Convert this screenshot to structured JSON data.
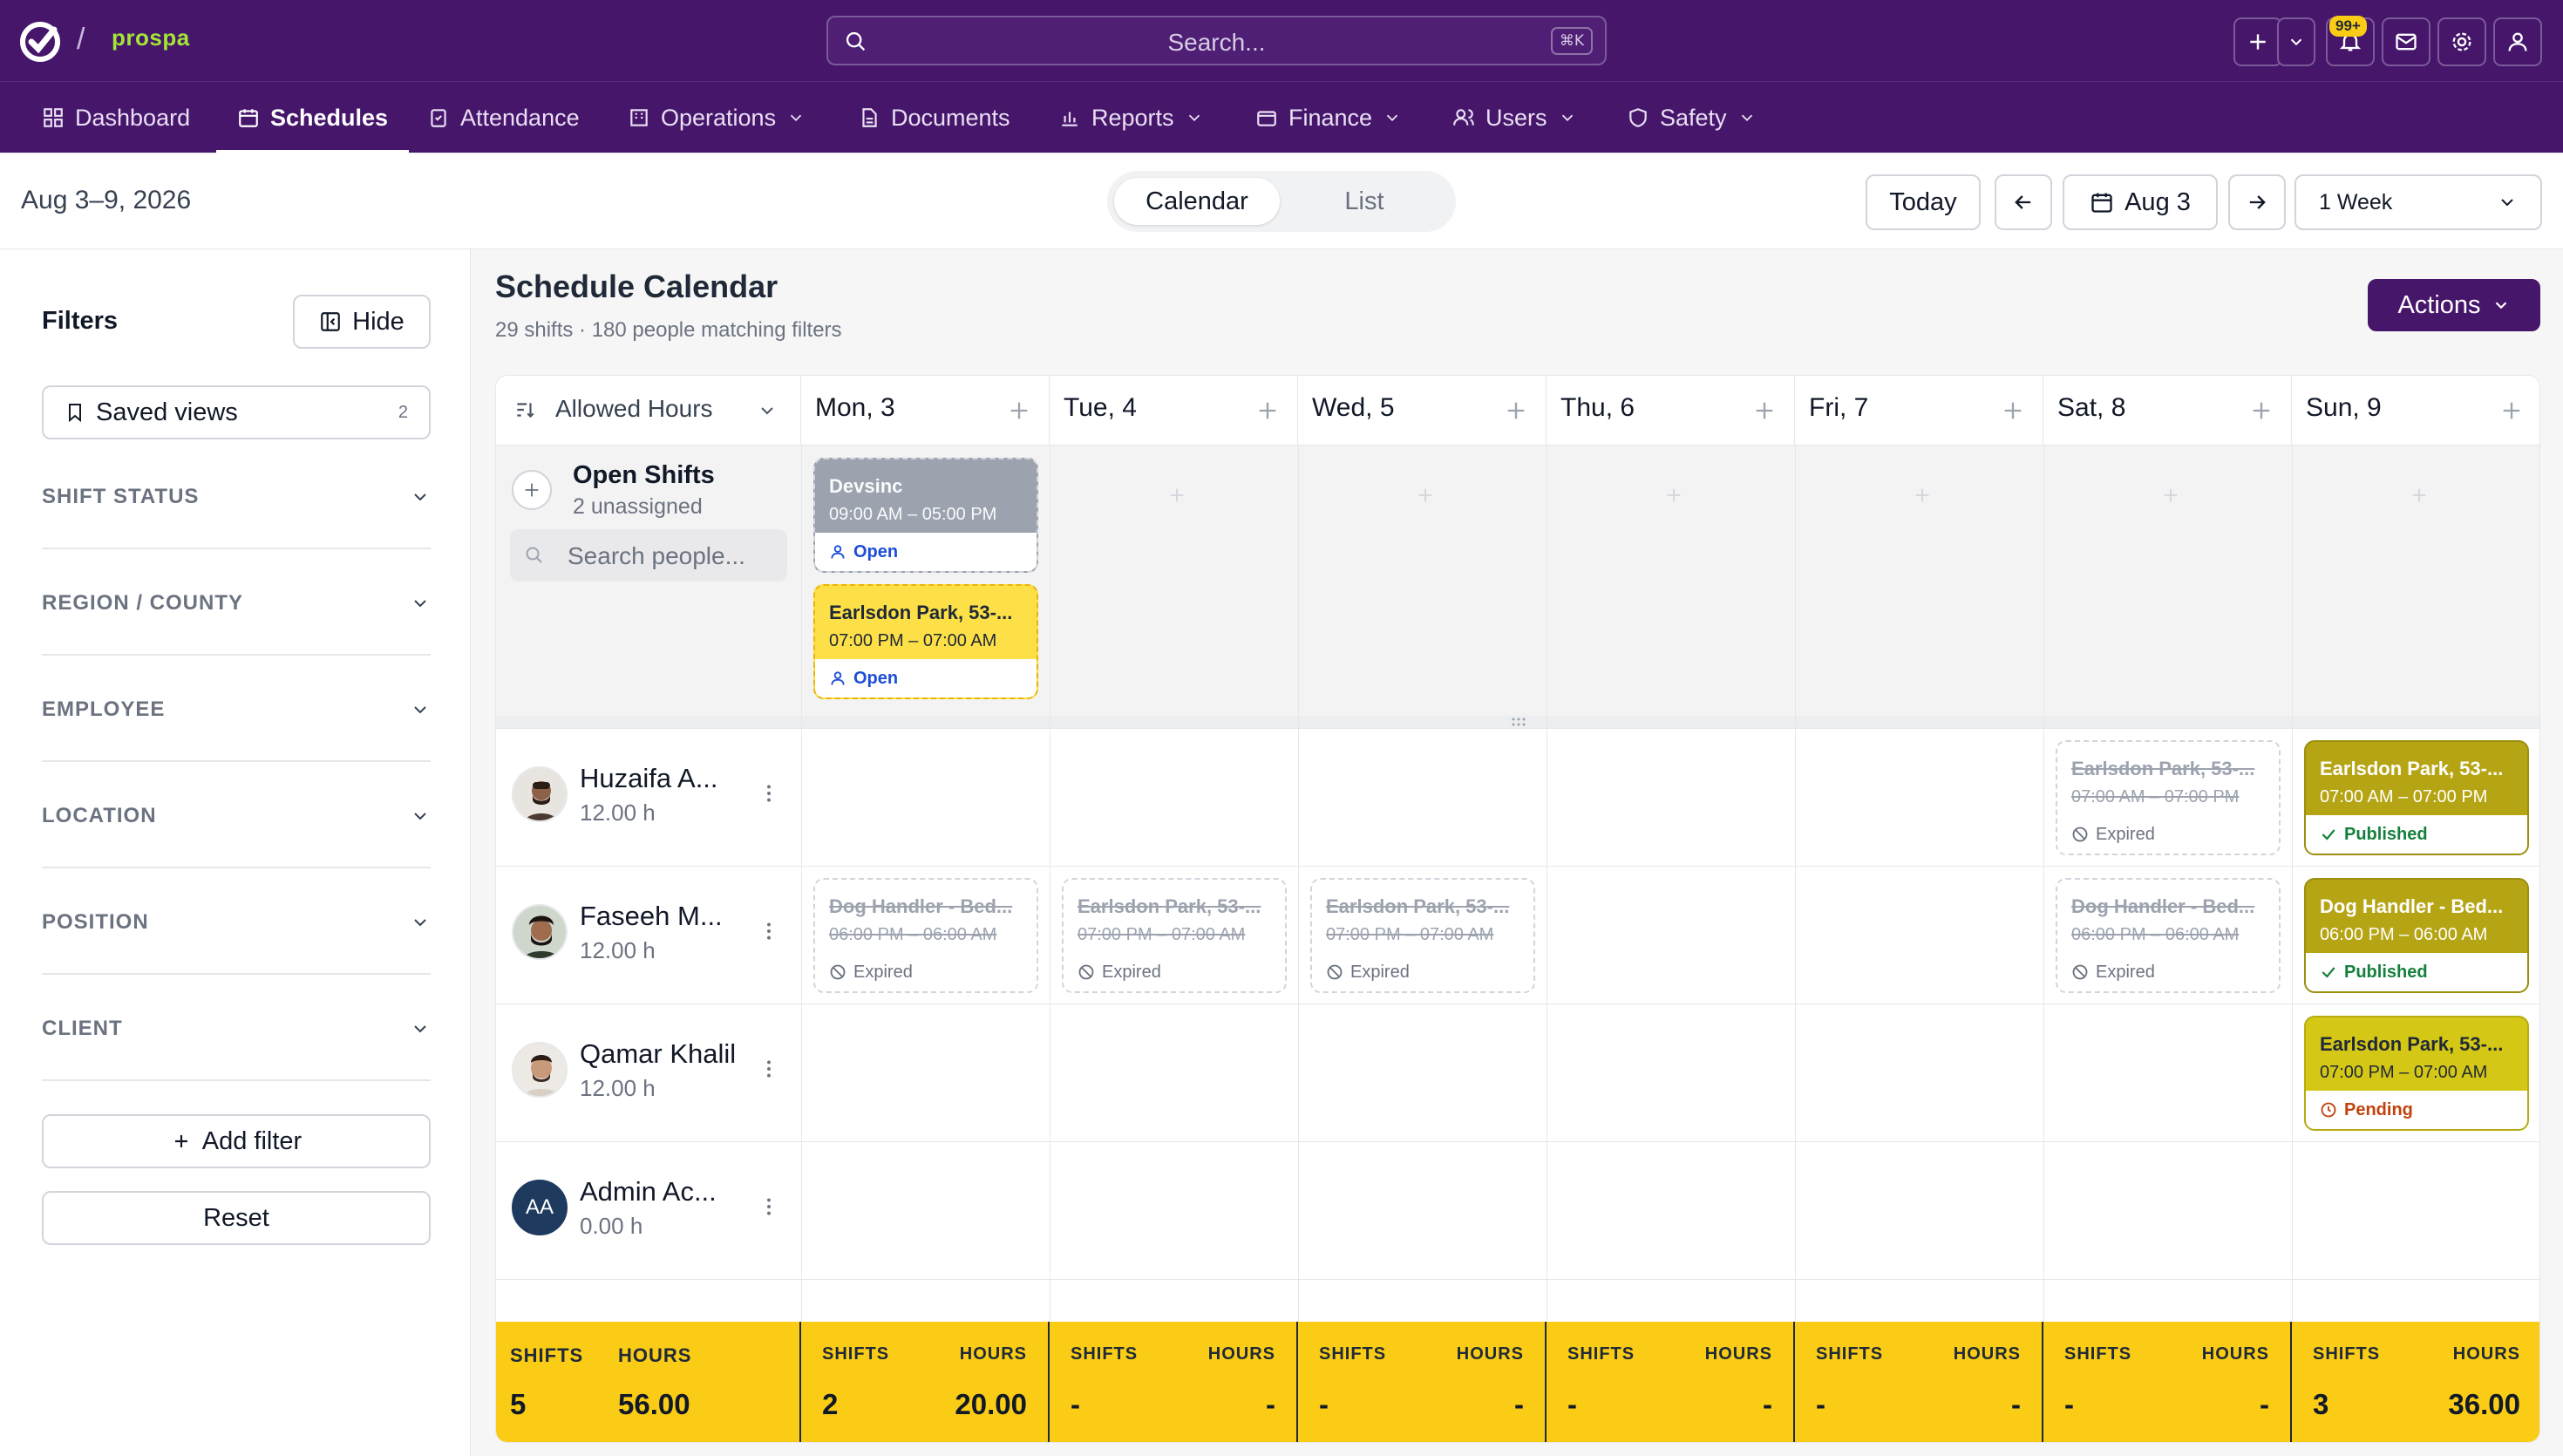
{
  "brand": {
    "name": "prospa",
    "accent": "#a3e635",
    "primary": "#46166b"
  },
  "search": {
    "placeholder": "Search...",
    "shortcut": "⌘K"
  },
  "topbar": {
    "notification_count": "99+",
    "icons": [
      "plus-icon",
      "chevron-down-icon",
      "bell-icon",
      "mail-icon",
      "gear-icon",
      "user-icon"
    ]
  },
  "nav": [
    {
      "label": "Dashboard",
      "icon": "grid-icon"
    },
    {
      "label": "Schedules",
      "icon": "calendar-icon",
      "active": true
    },
    {
      "label": "Attendance",
      "icon": "clipboard-icon"
    },
    {
      "label": "Operations",
      "icon": "building-icon",
      "dropdown": true
    },
    {
      "label": "Documents",
      "icon": "document-icon"
    },
    {
      "label": "Reports",
      "icon": "chart-icon",
      "dropdown": true
    },
    {
      "label": "Finance",
      "icon": "wallet-icon",
      "dropdown": true
    },
    {
      "label": "Users",
      "icon": "users-icon",
      "dropdown": true
    },
    {
      "label": "Safety",
      "icon": "shield-icon",
      "dropdown": true
    }
  ],
  "toolbar": {
    "date_range": "Aug 3–9, 2026",
    "view_toggle": [
      "Calendar",
      "List"
    ],
    "today": "Today",
    "current_date": "Aug 3",
    "range_select": "1 Week"
  },
  "filters": {
    "title": "Filters",
    "hide": "Hide",
    "saved_views": "Saved views",
    "saved_views_count": "2",
    "groups": [
      "SHIFT STATUS",
      "REGION / COUNTY",
      "EMPLOYEE",
      "LOCATION",
      "POSITION",
      "CLIENT"
    ],
    "add_filter": "Add filter",
    "reset": "Reset"
  },
  "main": {
    "title": "Schedule Calendar",
    "subtitle": "29 shifts · 180 people matching filters",
    "actions": "Actions",
    "sort_label": "Allowed Hours",
    "days": [
      "Mon, 3",
      "Tue, 4",
      "Wed, 5",
      "Thu, 6",
      "Fri, 7",
      "Sat, 8",
      "Sun, 9"
    ],
    "open_shifts": {
      "title": "Open Shifts",
      "subtitle": "2 unassigned",
      "search_placeholder": "Search people..."
    }
  },
  "open_shift_cards": [
    {
      "title": "Devsinc",
      "time": "09:00 AM – 05:00 PM",
      "status": "Open"
    },
    {
      "title": "Earlsdon Park, 53-...",
      "time": "07:00 PM – 07:00 AM",
      "status": "Open"
    }
  ],
  "people": [
    {
      "name": "Huzaifa A...",
      "hours": "12.00 h"
    },
    {
      "name": "Faseeh M...",
      "hours": "12.00 h"
    },
    {
      "name": "Qamar Khalil",
      "hours": "12.00 h"
    },
    {
      "name": "Admin Ac...",
      "hours": "0.00 h",
      "initials": "AA"
    }
  ],
  "shifts": [
    {
      "title": "Earlsdon Park, 53-...",
      "time": "07:00 AM – 07:00 PM",
      "status": "Expired"
    },
    {
      "title": "Earlsdon Park, 53-...",
      "time": "07:00 AM – 07:00 PM",
      "status": "Published"
    },
    {
      "title": "Dog Handler - Bed...",
      "time": "06:00 PM – 06:00 AM",
      "status": "Expired"
    },
    {
      "title": "Earlsdon Park, 53-...",
      "time": "07:00 PM – 07:00 AM",
      "status": "Expired"
    },
    {
      "title": "Earlsdon Park, 53-...",
      "time": "07:00 PM – 07:00 AM",
      "status": "Expired"
    },
    {
      "title": "Dog Handler - Bed...",
      "time": "06:00 PM – 06:00 AM",
      "status": "Expired"
    },
    {
      "title": "Dog Handler - Bed...",
      "time": "06:00 PM – 06:00 AM",
      "status": "Published"
    },
    {
      "title": "Earlsdon Park, 53-...",
      "time": "07:00 PM – 07:00 AM",
      "status": "Pending"
    }
  ],
  "summary": {
    "shifts_label": "SHIFTS",
    "hours_label": "HOURS",
    "total": {
      "shifts": "5",
      "hours": "56.00"
    },
    "days": [
      {
        "shifts": "2",
        "hours": "20.00"
      },
      {
        "shifts": "-",
        "hours": "-"
      },
      {
        "shifts": "-",
        "hours": "-"
      },
      {
        "shifts": "-",
        "hours": "-"
      },
      {
        "shifts": "-",
        "hours": "-"
      },
      {
        "shifts": "-",
        "hours": "-"
      },
      {
        "shifts": "3",
        "hours": "36.00"
      }
    ]
  }
}
